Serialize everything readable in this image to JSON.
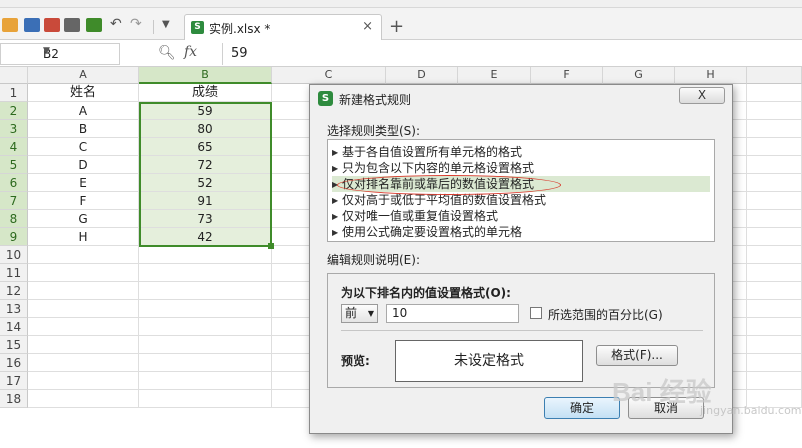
{
  "file_tab": {
    "name": "实例.xlsx *",
    "close": "×"
  },
  "new_tab_plus": "+",
  "formula_bar": {
    "name_box": "B2",
    "fx": "fx",
    "value": "59"
  },
  "columns": [
    "A",
    "B",
    "C",
    "D",
    "E",
    "F",
    "G",
    "H"
  ],
  "rows": [
    "1",
    "2",
    "3",
    "4",
    "5",
    "6",
    "7",
    "8",
    "9",
    "10",
    "11",
    "12",
    "13",
    "14",
    "15",
    "16",
    "17",
    "18"
  ],
  "sheet": {
    "header": {
      "A": "姓名",
      "B": "成绩"
    },
    "data": [
      {
        "A": "A",
        "B": "59"
      },
      {
        "A": "B",
        "B": "80"
      },
      {
        "A": "C",
        "B": "65"
      },
      {
        "A": "D",
        "B": "72"
      },
      {
        "A": "E",
        "B": "52"
      },
      {
        "A": "F",
        "B": "91"
      },
      {
        "A": "G",
        "B": "73"
      },
      {
        "A": "H",
        "B": "42"
      }
    ]
  },
  "dialog": {
    "title": "新建格式规则",
    "close_label": "X",
    "select_type_label": "选择规则类型(S):",
    "rule_types": [
      "基于各自值设置所有单元格的格式",
      "只为包含以下内容的单元格设置格式",
      "仅对排名靠前或靠后的数值设置格式",
      "仅对高于或低于平均值的数值设置格式",
      "仅对唯一值或重复值设置格式",
      "使用公式确定要设置格式的单元格"
    ],
    "selected_rule_index": 2,
    "edit_desc_label": "编辑规则说明(E):",
    "rule_title": "为以下排名内的值设置格式(O):",
    "rank_select": "前",
    "rank_value": "10",
    "percent_label": "所选范围的百分比(G)",
    "percent_checked": false,
    "preview_label": "预览:",
    "preview_text": "未设定格式",
    "format_button": "格式(F)...",
    "ok_button": "确定",
    "cancel_button": "取消"
  },
  "watermark": {
    "main": "Bai 经验",
    "sub": "jingyan.baidu.com"
  },
  "colors": {
    "accent_green": "#3f8b2a",
    "selected_fill": "#e5efdc",
    "highlight_circle": "#d8392b"
  }
}
